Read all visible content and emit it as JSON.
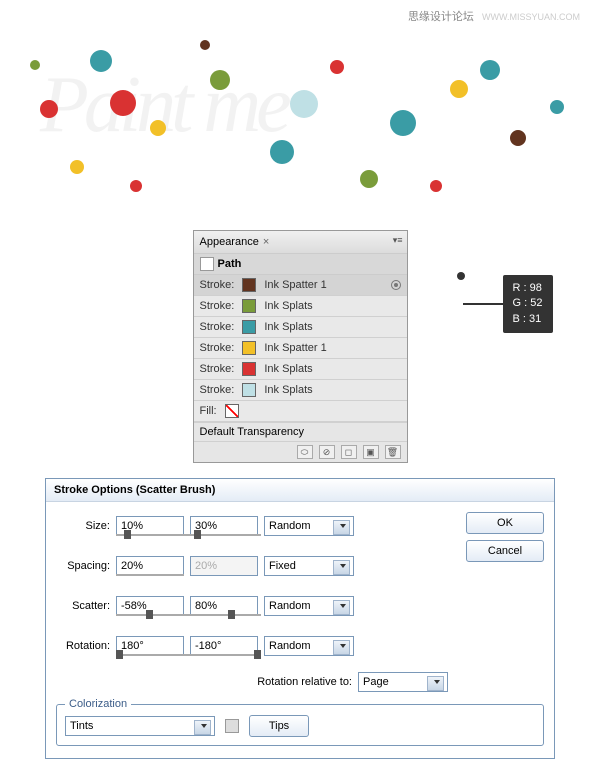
{
  "watermark": {
    "text": "思缘设计论坛",
    "url": "WWW.MISSYUAN.COM"
  },
  "appearance": {
    "tab": "Appearance",
    "close": "×",
    "pathLabel": "Path",
    "strokeLabel": "Stroke:",
    "fillLabel": "Fill:",
    "rows": [
      {
        "color": "#62341f",
        "name": "Ink Spatter 1"
      },
      {
        "color": "#7a9c3a",
        "name": "Ink Splats"
      },
      {
        "color": "#3a9ca5",
        "name": "Ink Splats"
      },
      {
        "color": "#f2c028",
        "name": "Ink Spatter 1"
      },
      {
        "color": "#d93232",
        "name": "Ink Splats"
      },
      {
        "color": "#bfe0e5",
        "name": "Ink Splats"
      }
    ],
    "defaultTransparency": "Default Transparency"
  },
  "rgb": {
    "r": "R : 98",
    "g": "G : 52",
    "b": "B : 31"
  },
  "strokeOptions": {
    "title": "Stroke Options (Scatter Brush)",
    "labels": {
      "size": "Size:",
      "spacing": "Spacing:",
      "scatter": "Scatter:",
      "rotation": "Rotation:",
      "rotRel": "Rotation relative to:",
      "colorization": "Colorization"
    },
    "values": {
      "size1": "10%",
      "size2": "30%",
      "sizeMode": "Random",
      "spacing1": "20%",
      "spacing2": "20%",
      "spacingMode": "Fixed",
      "scatter1": "-58%",
      "scatter2": "80%",
      "scatterMode": "Random",
      "rotation1": "180°",
      "rotation2": "-180°",
      "rotationMode": "Random",
      "rotRelValue": "Page",
      "colorizationMethod": "Tints"
    },
    "buttons": {
      "ok": "OK",
      "cancel": "Cancel",
      "tips": "Tips"
    }
  }
}
